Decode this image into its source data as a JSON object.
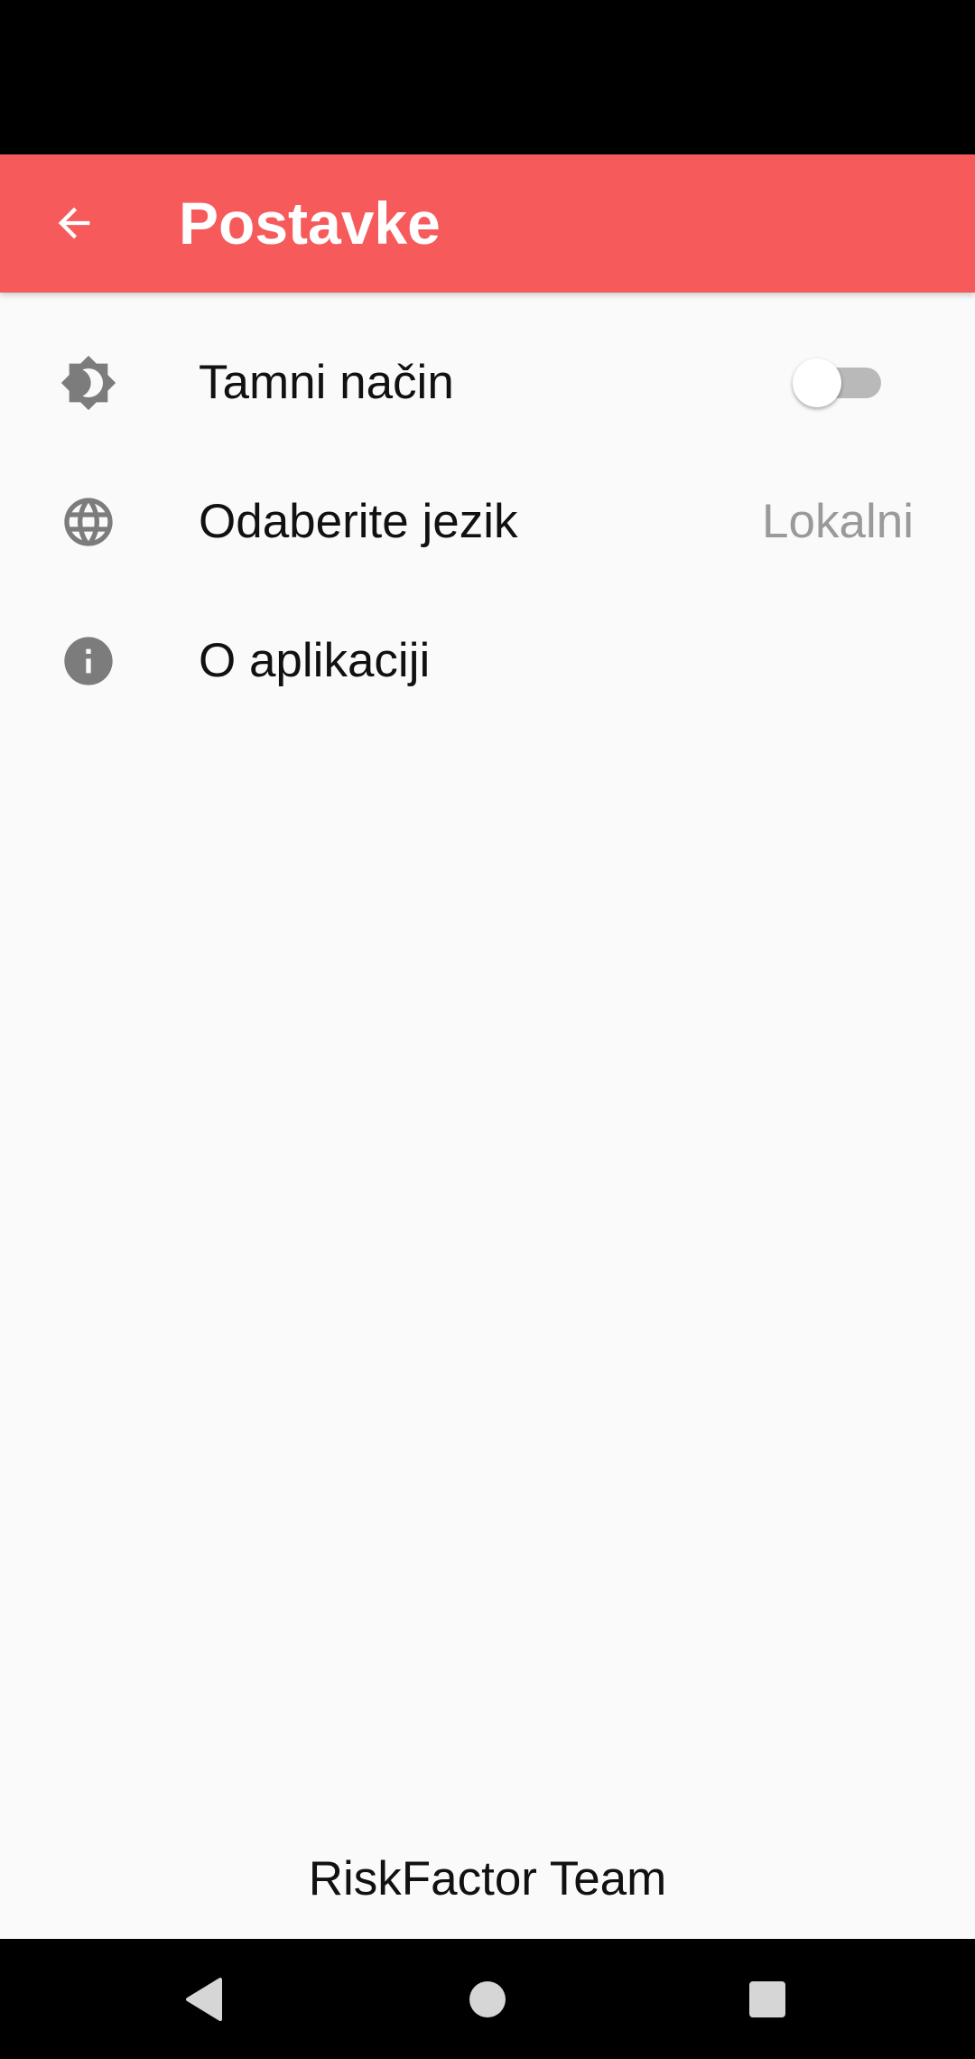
{
  "app_bar": {
    "title": "Postavke",
    "back_icon": "arrow-back-icon",
    "background_color": "#f65a5b"
  },
  "settings": {
    "items": [
      {
        "icon": "brightness-icon",
        "label": "Tamni način",
        "control": "toggle",
        "toggle_on": false
      },
      {
        "icon": "globe-icon",
        "label": "Odaberite jezik",
        "value": "Lokalni"
      },
      {
        "icon": "info-icon",
        "label": "O aplikaciji"
      }
    ]
  },
  "footer": {
    "text": "RiskFactor Team"
  },
  "navigation": {
    "back_icon": "nav-back-icon",
    "home_icon": "nav-home-icon",
    "recents_icon": "nav-recents-icon"
  }
}
